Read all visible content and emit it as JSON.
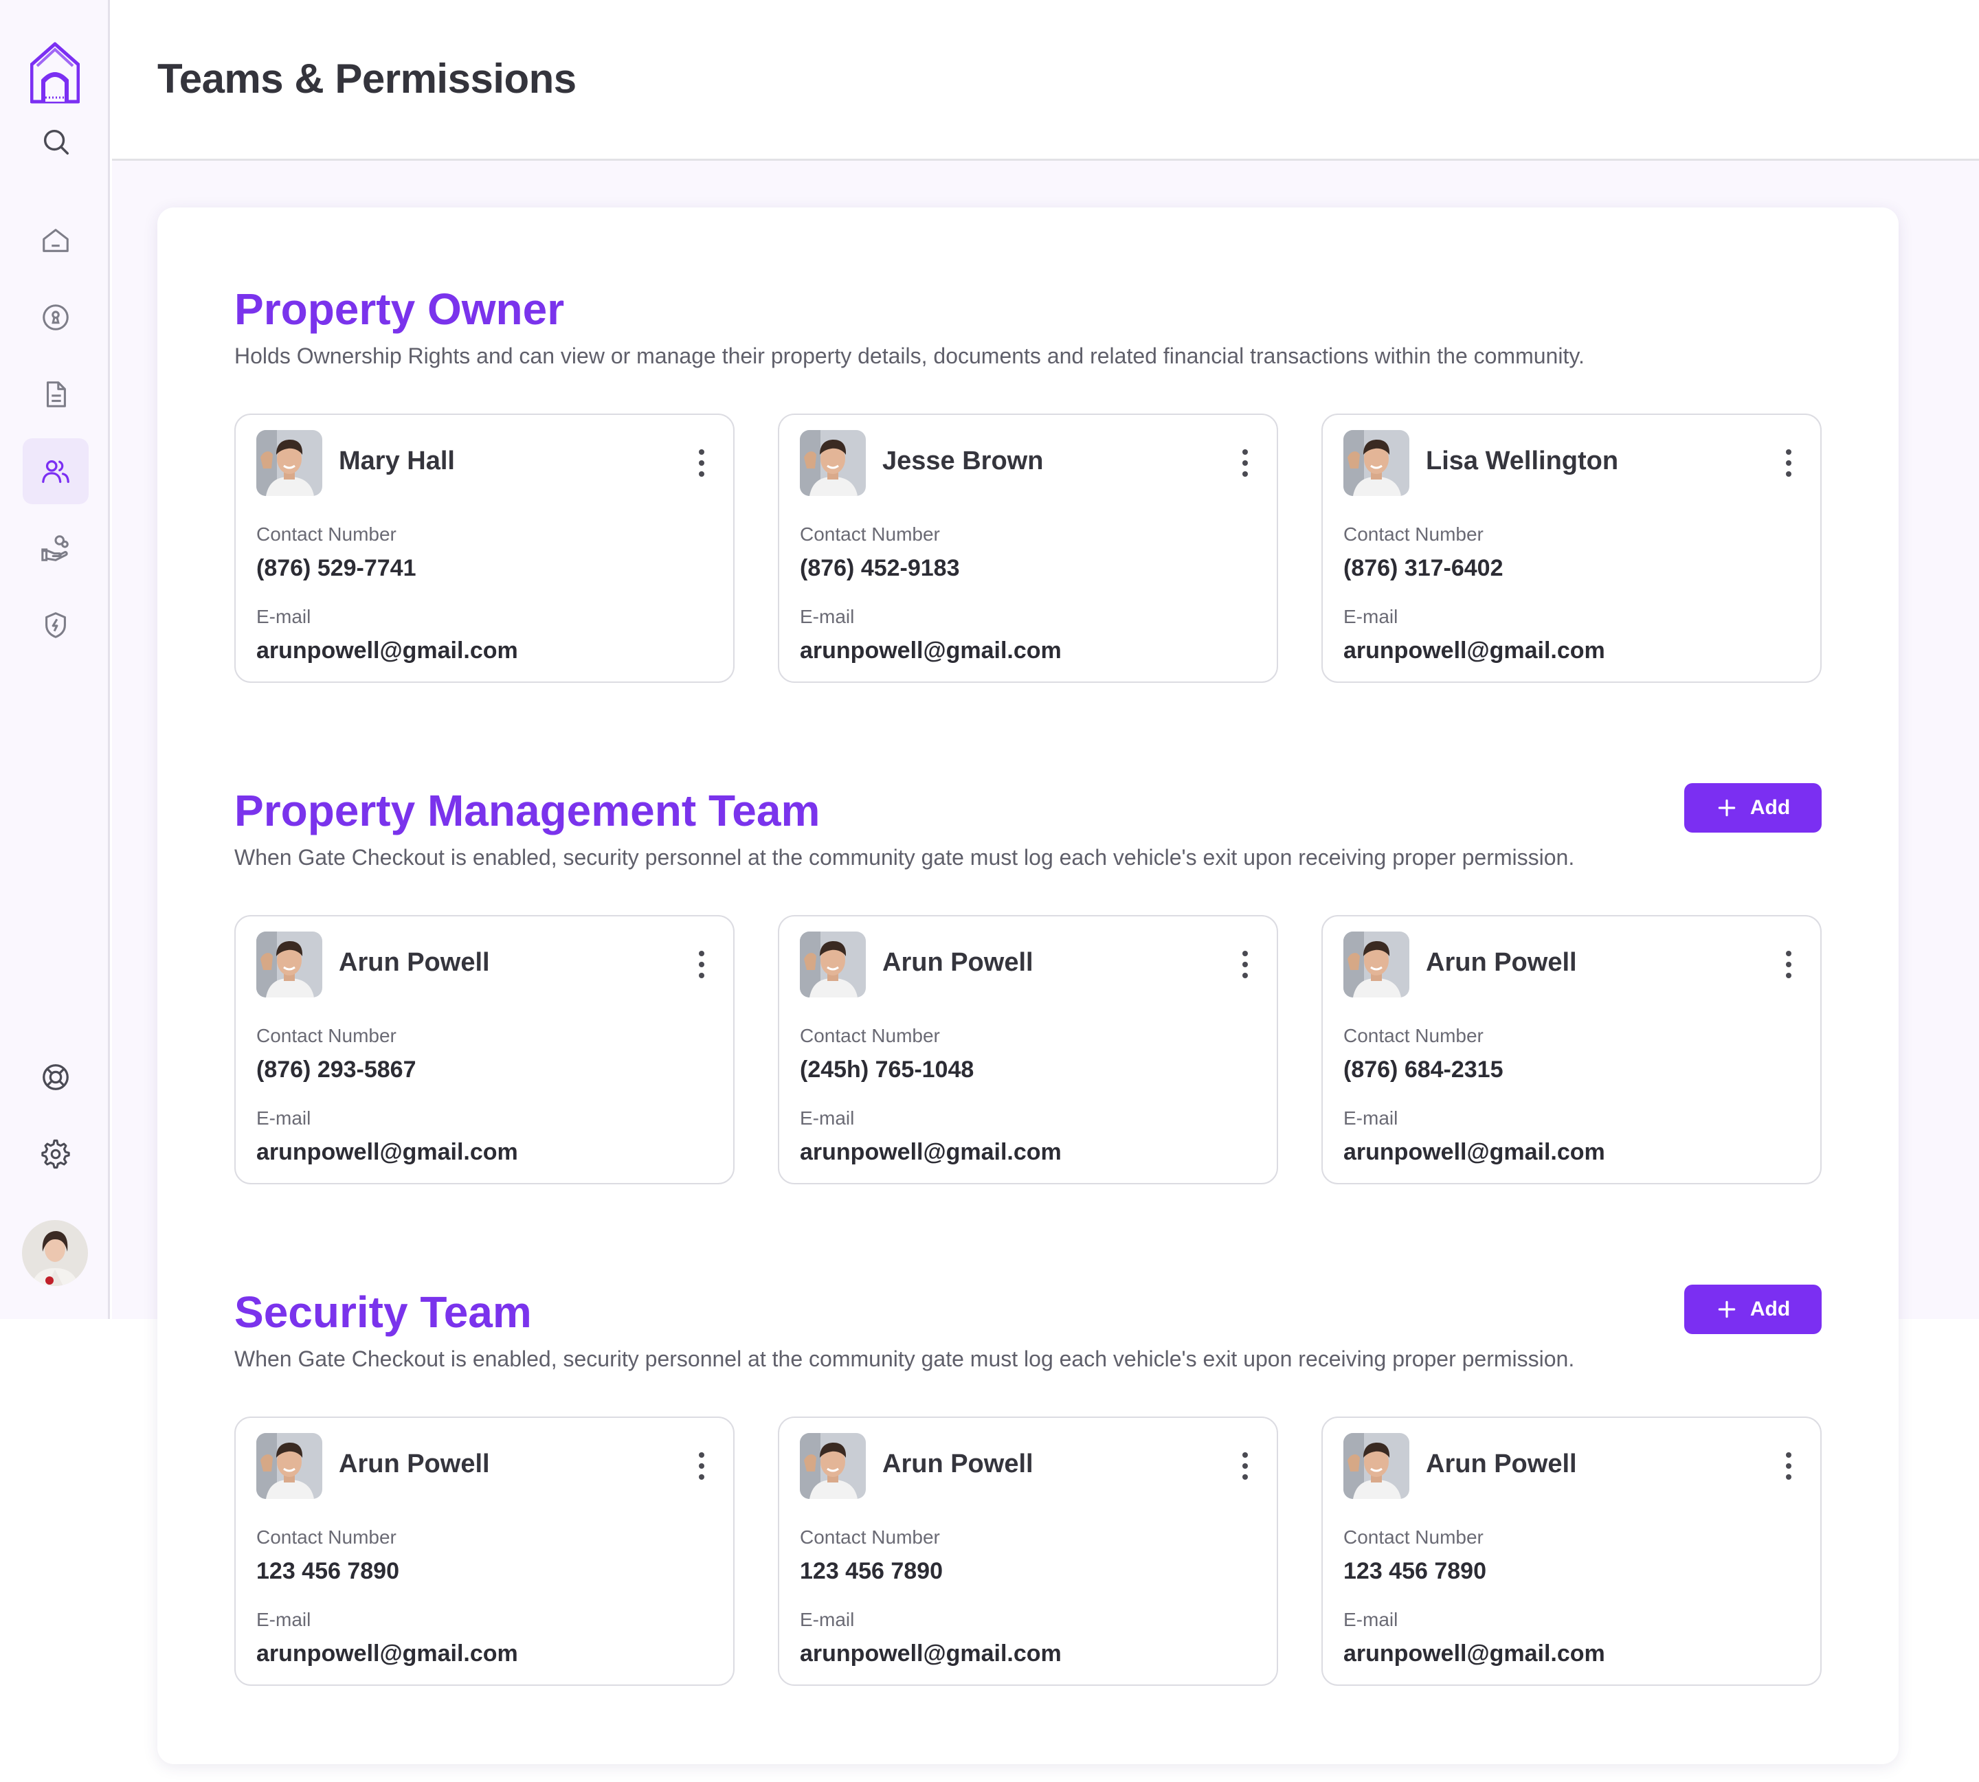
{
  "header": {
    "title": "Teams & Permissions"
  },
  "sidebar": {
    "items": [
      {
        "icon": "search-icon"
      },
      {
        "icon": "home-icon"
      },
      {
        "icon": "keyhole-icon"
      },
      {
        "icon": "document-icon"
      },
      {
        "icon": "users-icon",
        "active": true
      },
      {
        "icon": "hand-coins-icon"
      },
      {
        "icon": "shield-bolt-icon"
      },
      {
        "icon": "lifebuoy-icon"
      },
      {
        "icon": "settings-gear-icon"
      }
    ]
  },
  "colors": {
    "accent": "#7b2ff2",
    "title": "#7a33ec",
    "page_bg": "#faf7fe"
  },
  "sections": {
    "owner": {
      "title": "Property Owner",
      "description": "Holds Ownership Rights and can view or manage their property details, documents and related financial transactions within the community.",
      "cards": [
        {
          "name": "Mary Hall",
          "contact_label": "Contact Number",
          "phone": "(876) 529-7741",
          "email_label": "E-mail",
          "email": "arunpowell@gmail.com"
        },
        {
          "name": "Jesse Brown",
          "contact_label": "Contact Number",
          "phone": "(876) 452-9183",
          "email_label": "E-mail",
          "email": "arunpowell@gmail.com"
        },
        {
          "name": "Lisa Wellington",
          "contact_label": "Contact Number",
          "phone": "(876) 317-6402",
          "email_label": "E-mail",
          "email": "arunpowell@gmail.com"
        }
      ]
    },
    "management": {
      "title": "Property Management Team",
      "description": "When Gate Checkout is enabled, security personnel at the community gate must log each vehicle's exit upon receiving proper permission.",
      "add_label": "Add",
      "cards": [
        {
          "name": "Arun Powell",
          "contact_label": "Contact Number",
          "phone": "(876) 293-5867",
          "email_label": "E-mail",
          "email": "arunpowell@gmail.com"
        },
        {
          "name": "Arun Powell",
          "contact_label": "Contact Number",
          "phone": "(245h) 765-1048",
          "email_label": "E-mail",
          "email": "arunpowell@gmail.com"
        },
        {
          "name": "Arun Powell",
          "contact_label": "Contact Number",
          "phone": "(876) 684-2315",
          "email_label": "E-mail",
          "email": "arunpowell@gmail.com"
        }
      ]
    },
    "security": {
      "title": "Security Team",
      "description": "When Gate Checkout is enabled, security personnel at the community gate must log each vehicle's exit upon receiving proper permission.",
      "add_label": "Add",
      "cards": [
        {
          "name": "Arun Powell",
          "contact_label": "Contact Number",
          "phone": "123 456 7890",
          "email_label": "E-mail",
          "email": "arunpowell@gmail.com"
        },
        {
          "name": "Arun Powell",
          "contact_label": "Contact Number",
          "phone": "123 456 7890",
          "email_label": "E-mail",
          "email": "arunpowell@gmail.com"
        },
        {
          "name": "Arun Powell",
          "contact_label": "Contact Number",
          "phone": "123 456 7890",
          "email_label": "E-mail",
          "email": "arunpowell@gmail.com"
        }
      ]
    }
  }
}
